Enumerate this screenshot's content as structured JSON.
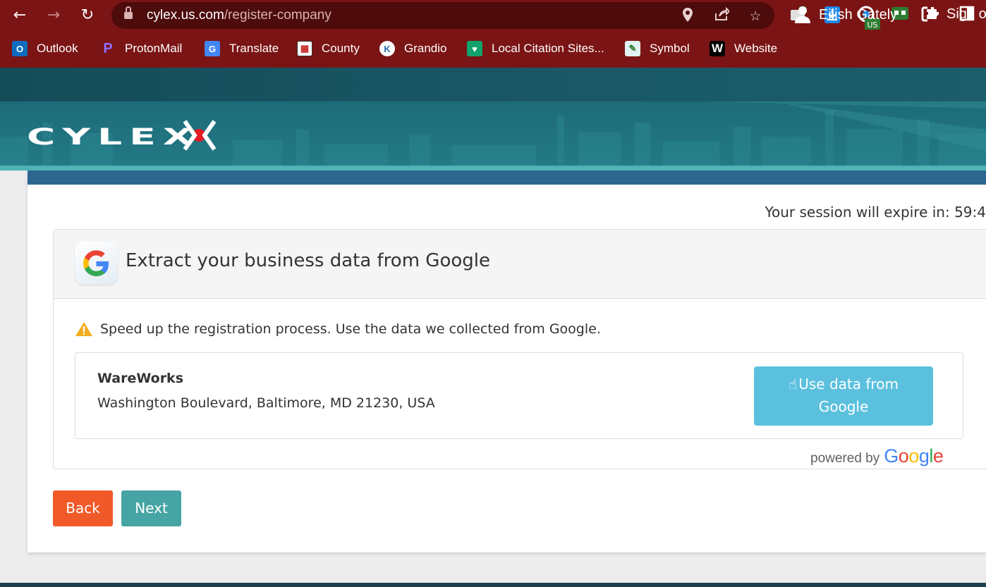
{
  "browser": {
    "url_host": "cylex.us.com",
    "url_path": "/register-company",
    "ext_badge": "US",
    "bookmarks": [
      {
        "label": "Outlook",
        "icon": "outlook-icon",
        "color": "#0f6cbd"
      },
      {
        "label": "ProtonMail",
        "icon": "protonmail-icon",
        "color": "#6d4aff"
      },
      {
        "label": "Translate",
        "icon": "google-translate-icon",
        "color": "#4285f4"
      },
      {
        "label": "County",
        "icon": "county-icon",
        "color": "#c62828"
      },
      {
        "label": "Grandio",
        "icon": "grandio-icon",
        "color": "#2f6fb3"
      },
      {
        "label": "Local Citation Sites...",
        "icon": "citation-icon",
        "color": "#11a36b"
      },
      {
        "label": "Symbol",
        "icon": "symbol-icon",
        "color": "#2e7d32"
      },
      {
        "label": "Website",
        "icon": "wix-icon",
        "color": "#000000"
      }
    ]
  },
  "site": {
    "user_name": "Eilish Gately",
    "sign_out": "Sign o",
    "logo_text": "CYLEX",
    "session_label": "Your session will expire in: 59:4"
  },
  "google_panel": {
    "title": "Extract your business data from Google",
    "warning": "Speed up the registration process. Use the data we collected from Google.",
    "business_name": "WareWorks",
    "business_address": "Washington Boulevard, Baltimore, MD 21230, USA",
    "use_button_line1": "Use data from",
    "use_button_line2": "Google",
    "powered_by": "powered by",
    "google_word": [
      "G",
      "o",
      "o",
      "g",
      "l",
      "e"
    ],
    "google_colors": [
      "#4285f4",
      "#ea4335",
      "#fbbc05",
      "#4285f4",
      "#34a853",
      "#ea4335"
    ]
  },
  "actions": {
    "back": "Back",
    "next": "Next"
  },
  "colors": {
    "browser_frame": "#7b1414",
    "site_header": "#164f5e",
    "card_topbar": "#2e6690",
    "use_button": "#5bc0de",
    "back_button": "#f05a28",
    "next_button": "#46a5a4"
  }
}
